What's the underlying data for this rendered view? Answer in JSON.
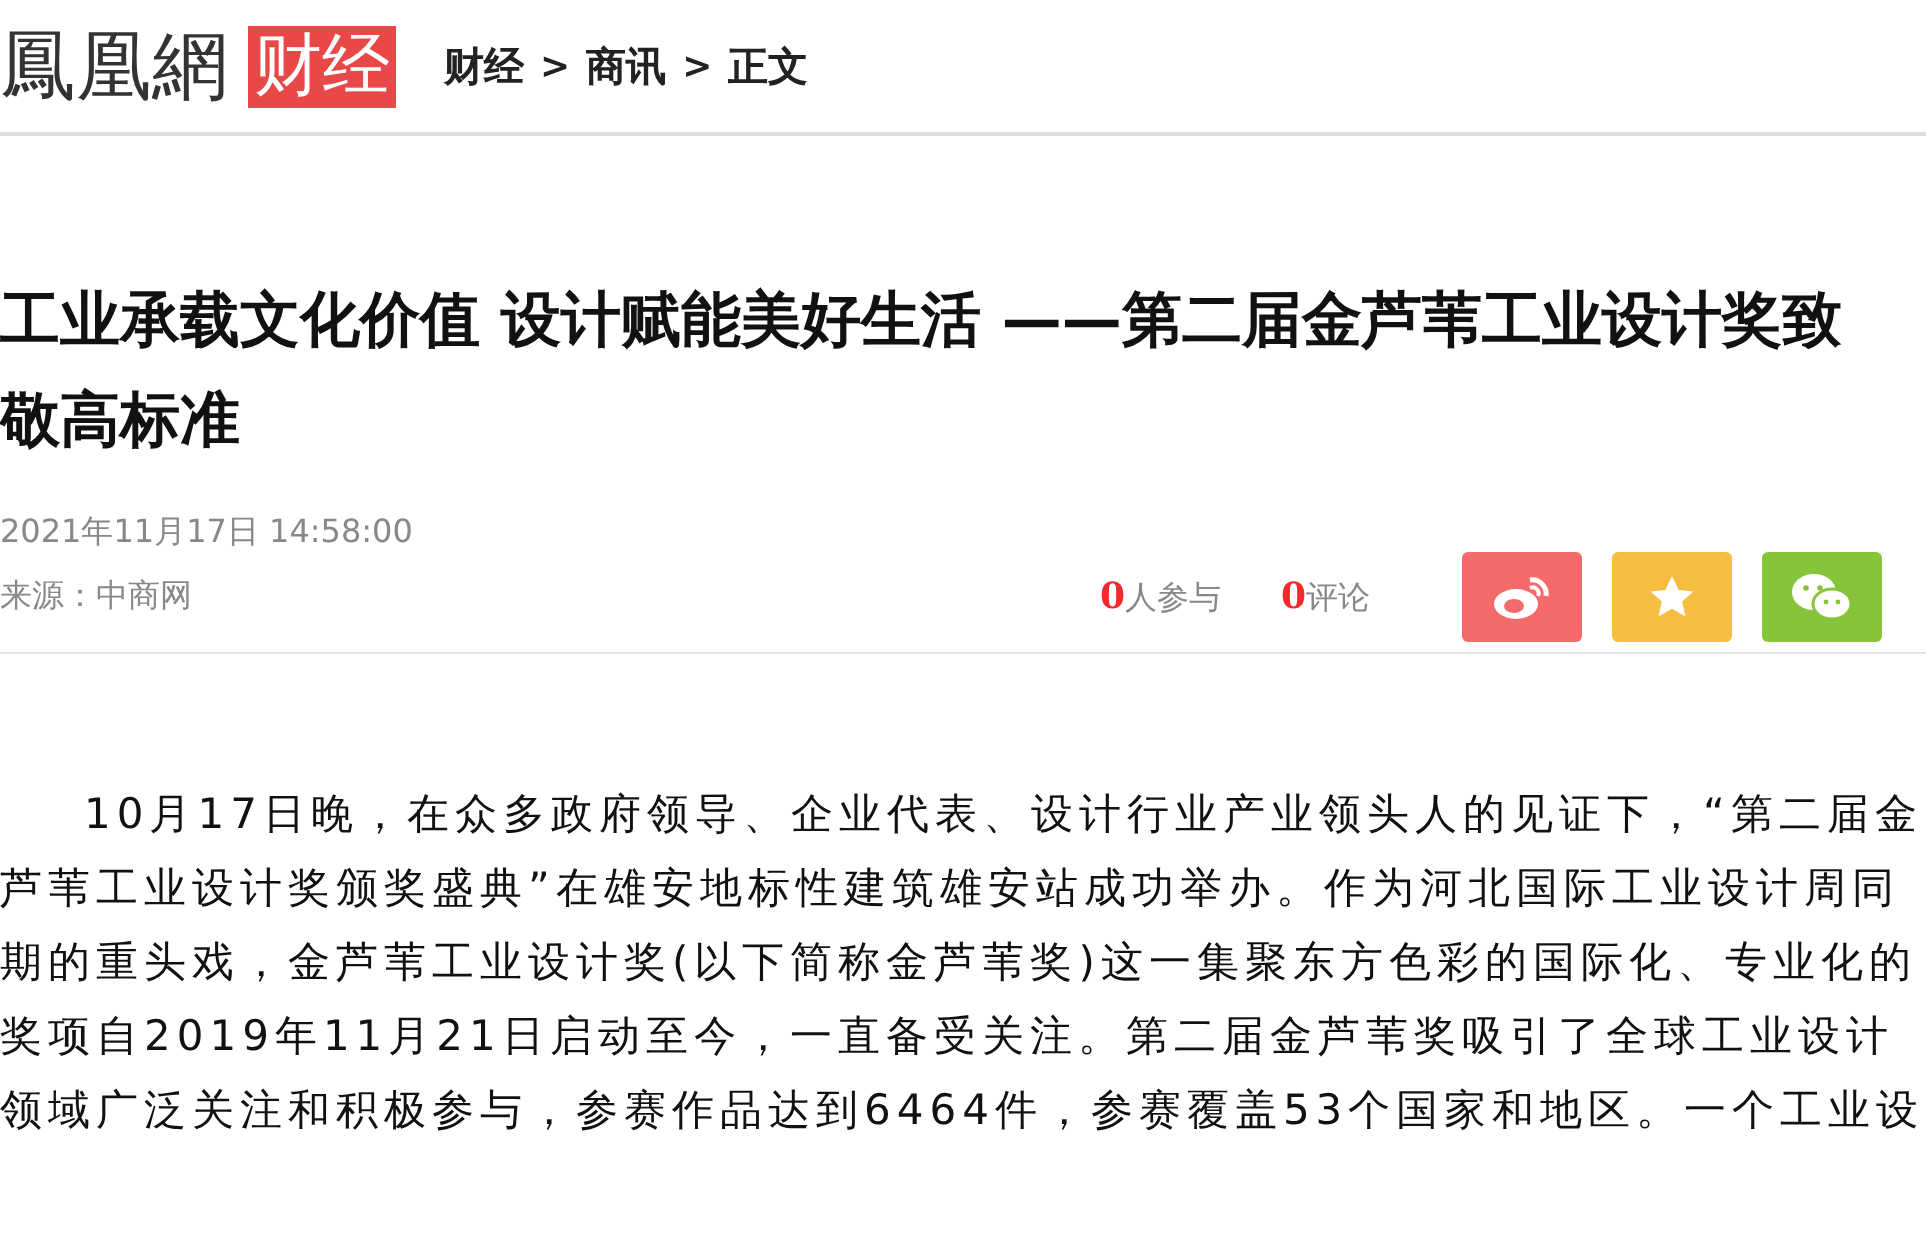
{
  "logo": {
    "brand": "鳳凰網",
    "channel": "财经"
  },
  "breadcrumb": [
    "财经",
    "商讯",
    "正文"
  ],
  "breadcrumb_separator": ">",
  "article": {
    "title": "工业承载文化价值 设计赋能美好生活 ——第二届金芦苇工业设计奖致敬高标准",
    "date": "2021年11月17日 14:58:00",
    "source": "来源：中商网",
    "participants": {
      "count": "0",
      "label": "人参与"
    },
    "comments": {
      "count": "0",
      "label": "评论"
    },
    "share_buttons": [
      {
        "kind": "weibo",
        "color": "#f56b6b"
      },
      {
        "kind": "favorite",
        "color": "#f5be41"
      },
      {
        "kind": "wechat",
        "color": "#86c43a"
      }
    ],
    "paragraph": "10月17日晚，在众多政府领导、企业代表、设计行业产业领头人的见证下，“第二届金芦苇工业设计奖颁奖盛典”在雄安地标性建筑雄安站成功举办。作为河北国际工业设计周同期的重头戏，金芦苇工业设计奖(以下简称金芦苇奖)这一集聚东方色彩的国际化、专业化的奖项自2019年11月21日启动至今，一直备受关注。第二届金芦苇奖吸引了全球工业设计领域广泛关注和积极参与，参赛作品达到6464件，参赛覆盖53个国家和地区。一个工业设"
  }
}
